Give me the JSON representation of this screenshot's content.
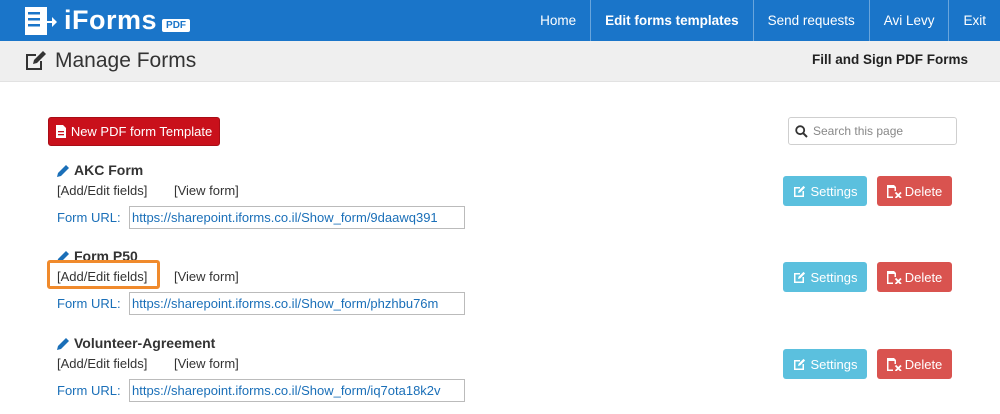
{
  "app": {
    "logo_text": "iForms",
    "logo_badge": "PDF"
  },
  "nav": [
    {
      "label": "Home",
      "active": false
    },
    {
      "label": "Edit forms templates",
      "active": true
    },
    {
      "label": "Send requests",
      "active": false
    },
    {
      "label": "Avi Levy",
      "active": false
    },
    {
      "label": "Exit",
      "active": false
    }
  ],
  "header": {
    "title": "Manage Forms",
    "subtitle": "Fill and Sign PDF Forms"
  },
  "toolbar": {
    "new_label": "New PDF form Template",
    "search_placeholder": "Search this page"
  },
  "forms_common": {
    "add_edit_label": "[Add/Edit fields]",
    "view_label": "[View form]",
    "url_label": "Form URL:",
    "settings_label": "Settings",
    "delete_label": "Delete"
  },
  "forms": [
    {
      "name": "AKC Form",
      "url": "https://sharepoint.iforms.co.il/Show_form/9daawq391"
    },
    {
      "name": "Form P50",
      "url": "https://sharepoint.iforms.co.il/Show_form/phzhbu76m"
    },
    {
      "name": "Volunteer-Agreement",
      "url": "https://sharepoint.iforms.co.il/Show_form/iq7ota18k2v"
    }
  ],
  "colors": {
    "navbar": "#1a75c9",
    "new_button": "#c9101b",
    "settings_button": "#5bc0de",
    "delete_button": "#d9534f",
    "highlight": "#f08a2c"
  }
}
